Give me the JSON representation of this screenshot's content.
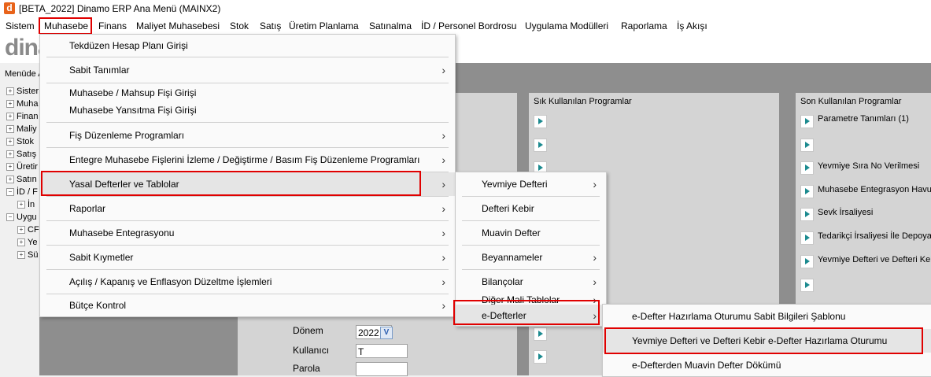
{
  "window": {
    "title": "[BETA_2022] Dinamo ERP Ana Menü (MAINX2)",
    "icon_letter": "d"
  },
  "menubar": [
    "Sistem",
    "Muhasebe",
    "Finans",
    "Maliyet Muhasebesi",
    "Stok",
    "Satış",
    "Üretim Planlama",
    "Satınalma",
    "İD / Personel Bordrosu",
    "Uygulama Modülleri",
    "Raporlama",
    "İş Akışı"
  ],
  "logo": "dina",
  "left_panel": {
    "header": "Menüde A",
    "tree": [
      "Sister",
      "Muha",
      "Finan",
      "Maliy",
      "Stok",
      "Satış",
      "Üretir",
      "Satın",
      "İD / F",
      "İn",
      "Uygu",
      "CF",
      "Ye",
      "Sü"
    ]
  },
  "frequent": {
    "title": "Sık Kullanılan Programlar"
  },
  "recent": {
    "title": "Son Kullanılan Programlar",
    "items": [
      "Parametre Tanımları (1)",
      "",
      "Yevmiye Sıra No Verilmesi",
      "Muhasebe Entegrasyon Havuz",
      "Sevk İrsaliyesi",
      "Tedarikçi İrsaliyesi İle Depoya",
      "Yevmiye Defteri ve Defteri Keb",
      ""
    ]
  },
  "login": {
    "period_label": "Dönem",
    "period_value": "2022",
    "user_label": "Kullanıcı",
    "user_value": "T",
    "password_label": "Parola",
    "password_value": ""
  },
  "muhasebe_menu": [
    "Tekdüzen Hesap Planı Girişi",
    "Sabit Tanımlar",
    "Muhasebe / Mahsup Fişi Girişi",
    "Muhasebe Yansıtma Fişi Girişi",
    "Fiş Düzenleme Programları",
    "Entegre Muhasebe Fişlerini İzleme / Değiştirme / Basım Fiş Düzenleme Programları",
    "Yasal Defterler ve Tablolar",
    "Raporlar",
    "Muhasebe Entegrasyonu",
    "Sabit Kıymetler",
    "Açılış / Kapanış ve  Enflasyon Düzeltme İşlemleri",
    "Bütçe Kontrol"
  ],
  "yasal_menu": [
    "Yevmiye Defteri",
    "Defteri Kebir",
    "Muavin Defter",
    "Beyannameler",
    "Bilançolar",
    "Diğer Mali Tablolar",
    "e-Defterler"
  ],
  "edefter_menu": [
    "e-Defter Hazırlama Oturumu Sabit Bilgileri Şablonu",
    "Yevmiye Defteri ve Defteri Kebir e-Defter Hazırlama Oturumu",
    "e-Defterden Muavin Defter Dökümü"
  ],
  "colors": {
    "highlight_border": "#e00000",
    "arrow": "#1b8a8f"
  }
}
